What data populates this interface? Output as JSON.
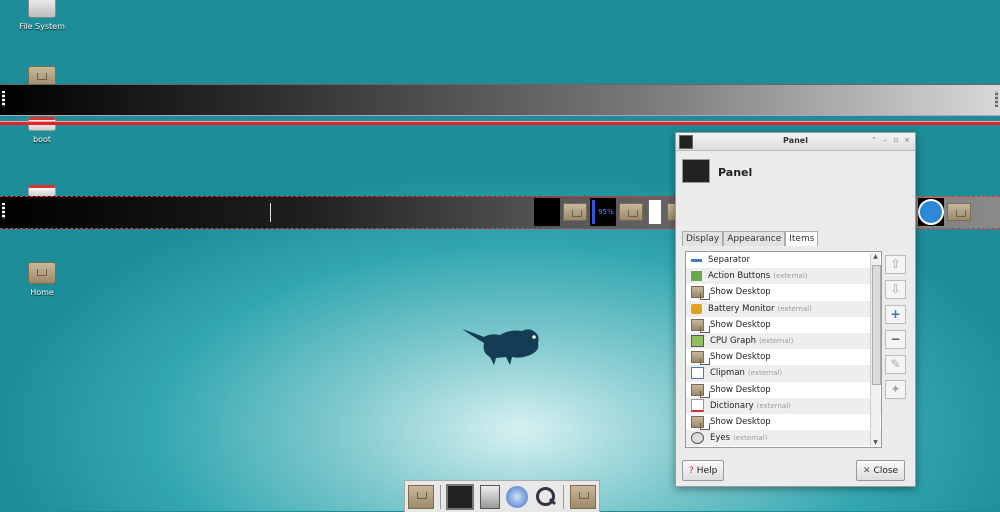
{
  "desktop": {
    "icons": [
      {
        "label": "File System",
        "icon": "drive-icon"
      },
      {
        "label": "",
        "icon": "home-folder-icon"
      },
      {
        "label": "boot",
        "icon": "drive-icon"
      },
      {
        "label": "",
        "icon": "drive-icon"
      },
      {
        "label": "Home",
        "icon": "home-folder-icon"
      }
    ]
  },
  "panel2": {
    "cpu_text": "95%"
  },
  "dialog": {
    "title": "Panel",
    "header_name": "Panel",
    "tabs": [
      "Display",
      "Appearance",
      "Items"
    ],
    "active_tab": "Items",
    "items": [
      {
        "label": "Separator",
        "ext": "",
        "icon": "separator-icon"
      },
      {
        "label": "Action Buttons",
        "ext": "(external)",
        "icon": "action-buttons-icon"
      },
      {
        "label": "Show Desktop",
        "ext": "",
        "icon": "folder-icon"
      },
      {
        "label": "Battery Monitor",
        "ext": "(external)",
        "icon": "battery-icon"
      },
      {
        "label": "Show Desktop",
        "ext": "",
        "icon": "folder-icon"
      },
      {
        "label": "CPU Graph",
        "ext": "(external)",
        "icon": "cpu-graph-icon"
      },
      {
        "label": "Show Desktop",
        "ext": "",
        "icon": "folder-icon"
      },
      {
        "label": "Clipman",
        "ext": "(external)",
        "icon": "clipboard-icon"
      },
      {
        "label": "Show Desktop",
        "ext": "",
        "icon": "folder-icon"
      },
      {
        "label": "Dictionary",
        "ext": "(external)",
        "icon": "dictionary-icon"
      },
      {
        "label": "Show Desktop",
        "ext": "",
        "icon": "folder-icon"
      },
      {
        "label": "Eyes",
        "ext": "(external)",
        "icon": "eyes-icon"
      }
    ],
    "help_label": "Help",
    "close_label": "Close"
  },
  "colors": {
    "panel_highlight": "#e8222a",
    "accent": "#4a78c0"
  }
}
